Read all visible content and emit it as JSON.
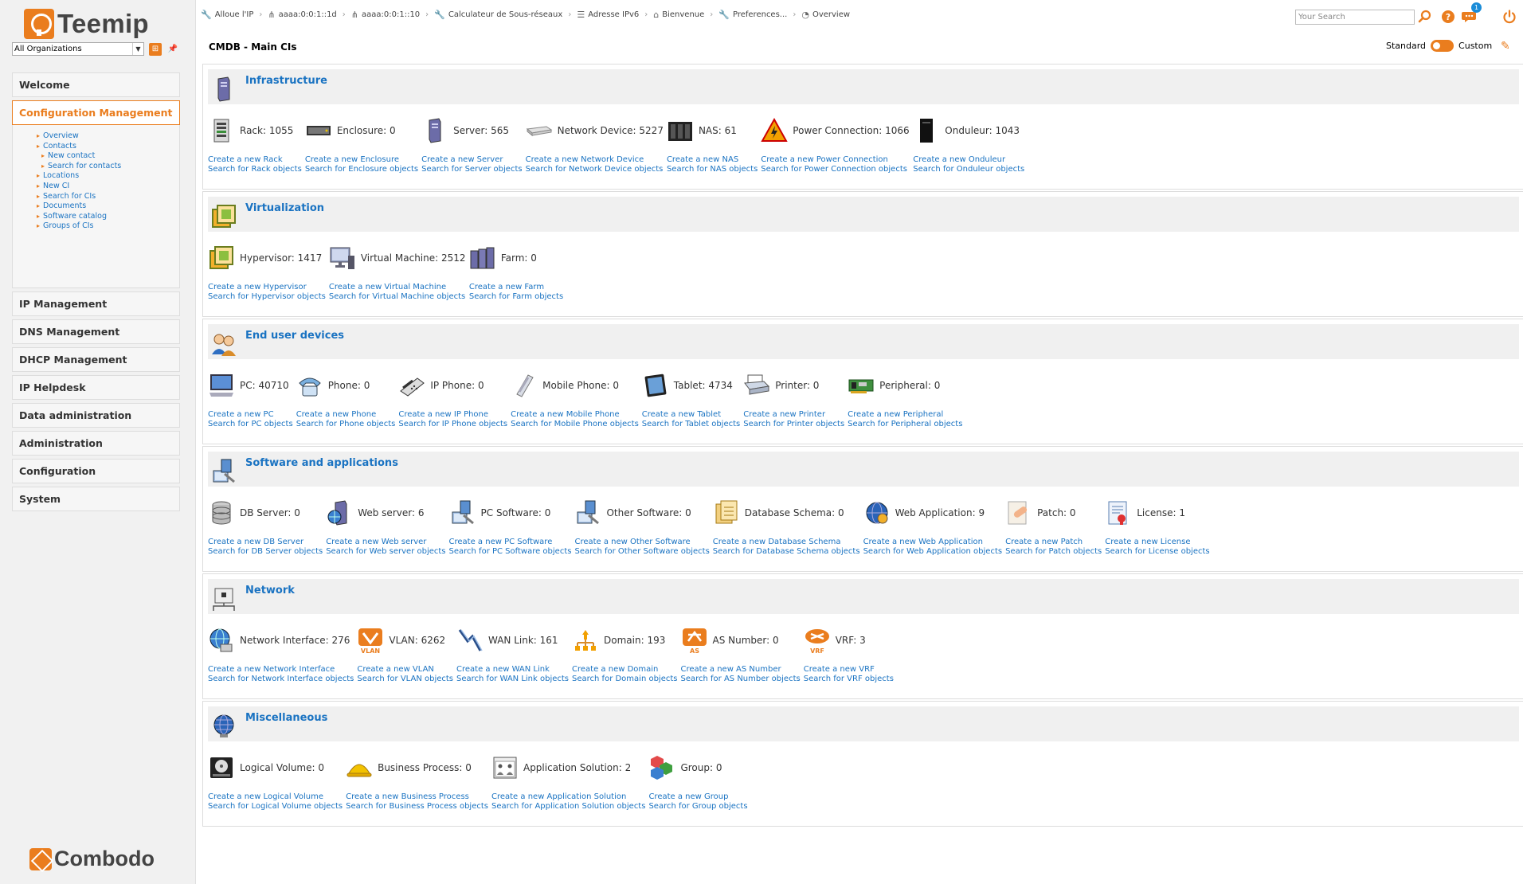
{
  "app": {
    "name": "Teemip",
    "vendor": "Combodo"
  },
  "colors": {
    "accent": "#ea7d1e",
    "link": "#1a73c2"
  },
  "org_select": {
    "value": "All Organizations"
  },
  "menu": [
    {
      "label": "Welcome",
      "active": false
    },
    {
      "label": "Configuration Management",
      "active": true
    },
    {
      "label": "IP Management",
      "active": false
    },
    {
      "label": "DNS Management",
      "active": false
    },
    {
      "label": "DHCP Management",
      "active": false
    },
    {
      "label": "IP Helpdesk",
      "active": false
    },
    {
      "label": "Data administration",
      "active": false
    },
    {
      "label": "Administration",
      "active": false
    },
    {
      "label": "Configuration",
      "active": false
    },
    {
      "label": "System",
      "active": false
    }
  ],
  "submenu": {
    "overview": "Overview",
    "contacts": "Contacts",
    "new_contact": "New contact",
    "search_contacts": "Search for contacts",
    "locations": "Locations",
    "new_ci": "New CI",
    "search_cis": "Search for CIs",
    "documents": "Documents",
    "software_catalog": "Software catalog",
    "groups_of_cis": "Groups of CIs"
  },
  "breadcrumbs": [
    {
      "icon": "wrench-icon",
      "label": "Alloue l'IP"
    },
    {
      "icon": "network-icon",
      "label": "aaaa:0:0:1::1d"
    },
    {
      "icon": "network-icon",
      "label": "aaaa:0:0:1::10"
    },
    {
      "icon": "wrench-icon",
      "label": "Calculateur de Sous-réseaux"
    },
    {
      "icon": "list-icon",
      "label": "Adresse IPv6"
    },
    {
      "icon": "home-icon",
      "label": "Bienvenue"
    },
    {
      "icon": "wrench-icon",
      "label": "Preferences..."
    },
    {
      "icon": "overview-icon",
      "label": "Overview"
    }
  ],
  "search": {
    "placeholder": "Your Search"
  },
  "notifications": {
    "count": "1"
  },
  "page": {
    "title": "CMDB - Main CIs",
    "toggle_left": "Standard",
    "toggle_right": "Custom"
  },
  "sections": [
    {
      "title": "Infrastructure",
      "icon": "server-icon",
      "items": [
        {
          "label": "Rack: 1055",
          "create": "Create a new Rack",
          "search": "Search for Rack objects",
          "icon": "rack-icon",
          "w": 112
        },
        {
          "label": "Enclosure: 0",
          "create": "Create a new Enclosure",
          "search": "Search for Enclosure objects",
          "icon": "enclosure-icon",
          "w": 127
        },
        {
          "label": "Server: 565",
          "create": "Create a new Server",
          "search": "Search for Server objects",
          "icon": "server-icon",
          "w": 115
        },
        {
          "label": "Network Device: 5227",
          "create": "Create a new Network Device",
          "search": "Search for Network Device objects",
          "icon": "network-device-icon",
          "w": 171
        },
        {
          "label": "NAS: 61",
          "create": "Create a new NAS",
          "search": "Search for NAS objects",
          "icon": "nas-icon",
          "w": 106
        },
        {
          "label": "Power Connection: 1066",
          "create": "Create a new Power Connection",
          "search": "Search for Power Connection objects",
          "icon": "power-icon",
          "w": 187
        },
        {
          "label": "Onduleur: 1043",
          "create": "Create a new Onduleur",
          "search": "Search for Onduleur objects",
          "icon": "ups-icon",
          "w": 140
        }
      ]
    },
    {
      "title": "Virtualization",
      "icon": "virtualization-icon",
      "items": [
        {
          "label": "Hypervisor: 1417",
          "create": "Create a new Hypervisor",
          "search": "Search for Hypervisor objects",
          "icon": "hypervisor-icon",
          "w": 137
        },
        {
          "label": "Virtual Machine: 2512",
          "create": "Create a new Virtual Machine",
          "search": "Search for Virtual Machine objects",
          "icon": "vm-icon",
          "w": 172
        },
        {
          "label": "Farm: 0",
          "create": "Create a new Farm",
          "search": "Search for Farm objects",
          "icon": "farm-icon",
          "w": 120
        }
      ]
    },
    {
      "title": "End user devices",
      "icon": "users-icon",
      "items": [
        {
          "label": "PC: 40710",
          "create": "Create a new PC",
          "search": "Search for PC objects",
          "icon": "pc-icon",
          "w": 106
        },
        {
          "label": "Phone: 0",
          "create": "Create a new Phone",
          "search": "Search for Phone objects",
          "icon": "phone-icon",
          "w": 116
        },
        {
          "label": "IP Phone: 0",
          "create": "Create a new IP Phone",
          "search": "Search for IP Phone objects",
          "icon": "ip-phone-icon",
          "w": 126
        },
        {
          "label": "Mobile Phone: 0",
          "create": "Create a new Mobile Phone",
          "search": "Search for Mobile Phone objects",
          "icon": "mobile-icon",
          "w": 150
        },
        {
          "label": "Tablet: 4734",
          "create": "Create a new Tablet",
          "search": "Search for Tablet objects",
          "icon": "tablet-icon",
          "w": 120
        },
        {
          "label": "Printer: 0",
          "create": "Create a new Printer",
          "search": "Search for Printer objects",
          "icon": "printer-icon",
          "w": 116
        },
        {
          "label": "Peripheral: 0",
          "create": "Create a new Peripheral",
          "search": "Search for Peripheral objects",
          "icon": "peripheral-icon",
          "w": 130
        }
      ]
    },
    {
      "title": "Software and applications",
      "icon": "software-icon",
      "items": [
        {
          "label": "DB Server: 0",
          "create": "Create a new DB Server",
          "search": "Search for DB Server objects",
          "icon": "db-server-icon",
          "w": 132
        },
        {
          "label": "Web server: 6",
          "create": "Create a new Web server",
          "search": "Search for Web server objects",
          "icon": "web-server-icon",
          "w": 140
        },
        {
          "label": "PC Software: 0",
          "create": "Create a new PC Software",
          "search": "Search for PC Software objects",
          "icon": "pc-software-icon",
          "w": 141
        },
        {
          "label": "Other Software: 0",
          "create": "Create a new Other Software",
          "search": "Search for Other Software objects",
          "icon": "other-software-icon",
          "w": 155
        },
        {
          "label": "Database Schema: 0",
          "create": "Create a new Database Schema",
          "search": "Search for Database Schema objects",
          "icon": "db-schema-icon",
          "w": 166
        },
        {
          "label": "Web Application: 9",
          "create": "Create a new Web Application",
          "search": "Search for Web Application objects",
          "icon": "web-app-icon",
          "w": 160
        },
        {
          "label": "Patch: 0",
          "create": "Create a new Patch",
          "search": "Search for Patch objects",
          "icon": "patch-icon",
          "w": 110
        },
        {
          "label": "License: 1",
          "create": "Create a new License",
          "search": "Search for License objects",
          "icon": "license-icon",
          "w": 120
        }
      ]
    },
    {
      "title": "Network",
      "icon": "network-icon",
      "items": [
        {
          "label": "Network Interface: 276",
          "create": "Create a new Network Interface",
          "search": "Search for Network Interface objects",
          "icon": "network-interface-icon",
          "w": 178
        },
        {
          "label": "VLAN: 6262",
          "create": "Create a new VLAN",
          "search": "Search for VLAN objects",
          "icon": "vlan-icon",
          "w": 113
        },
        {
          "label": "WAN Link: 161",
          "create": "Create a new WAN Link",
          "search": "Search for WAN Link objects",
          "icon": "wan-link-icon",
          "w": 132
        },
        {
          "label": "Domain: 193",
          "create": "Create a new Domain",
          "search": "Search for Domain objects",
          "icon": "domain-icon",
          "w": 118
        },
        {
          "label": "AS Number: 0",
          "create": "Create a new AS Number",
          "search": "Search for AS Number objects",
          "icon": "as-number-icon",
          "w": 138
        },
        {
          "label": "VRF: 3",
          "create": "Create a new VRF",
          "search": "Search for VRF objects",
          "icon": "vrf-icon",
          "w": 110
        }
      ]
    },
    {
      "title": "Miscellaneous",
      "icon": "globe-icon",
      "items": [
        {
          "label": "Logical Volume: 0",
          "create": "Create a new Logical Volume",
          "search": "Search for Logical Volume objects",
          "icon": "logical-volume-icon",
          "w": 152
        },
        {
          "label": "Business Process: 0",
          "create": "Create a new Business Process",
          "search": "Search for Business Process objects",
          "icon": "business-process-icon",
          "w": 161
        },
        {
          "label": "Application Solution: 2",
          "create": "Create a new Application Solution",
          "search": "Search for Application Solution objects",
          "icon": "application-solution-icon",
          "w": 180
        },
        {
          "label": "Group: 0",
          "create": "Create a new Group",
          "search": "Search for Group objects",
          "icon": "group-icon",
          "w": 120
        }
      ]
    }
  ]
}
